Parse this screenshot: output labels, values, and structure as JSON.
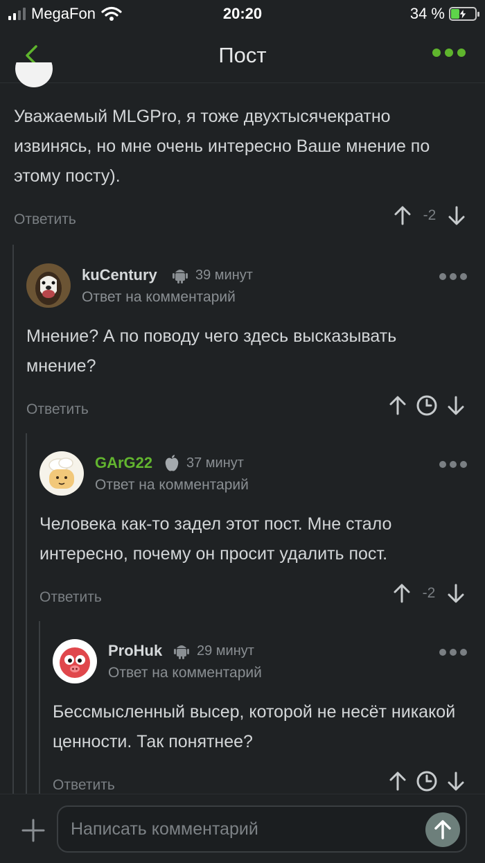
{
  "status_bar": {
    "carrier": "MegaFon",
    "time": "20:20",
    "battery_text": "34 %",
    "battery_level": 0.34
  },
  "nav": {
    "title": "Пост",
    "back_icon": "chevron-left-icon",
    "more_icon": "more-dots-icon"
  },
  "top_comment": {
    "text": "Уважаемый MLGPro, я тоже двухтысячекратно извинясь, но мне очень интересно Ваше мнение по этому посту).",
    "reply_label": "Ответить",
    "score": "-2"
  },
  "comments": [
    {
      "author": "kuCentury",
      "platform": "android",
      "time": "39 минут",
      "subtitle": "Ответ на комментарий",
      "text": "Мнение? А по поводу чего здесь высказывать мнение?",
      "reply_label": "Ответить",
      "score": ""
    },
    {
      "author": "GArG22",
      "platform": "apple",
      "time": "37 минут",
      "subtitle": "Ответ на комментарий",
      "text": "Человека как-то задел этот пост. Мне стало интересно, почему он просит удалить пост.",
      "reply_label": "Ответить",
      "score": "-2"
    },
    {
      "author": "ProHuk",
      "platform": "android",
      "time": "29 минут",
      "subtitle": "Ответ на комментарий",
      "text": "Бессмысленный высер, которой не несёт никакой ценности. Так понятнее?",
      "reply_label": "Ответить",
      "score": ""
    }
  ],
  "composer": {
    "placeholder": "Написать комментарий"
  },
  "colors": {
    "accent": "#5fb52d",
    "background": "#1f2224",
    "muted": "#7a7f83"
  }
}
